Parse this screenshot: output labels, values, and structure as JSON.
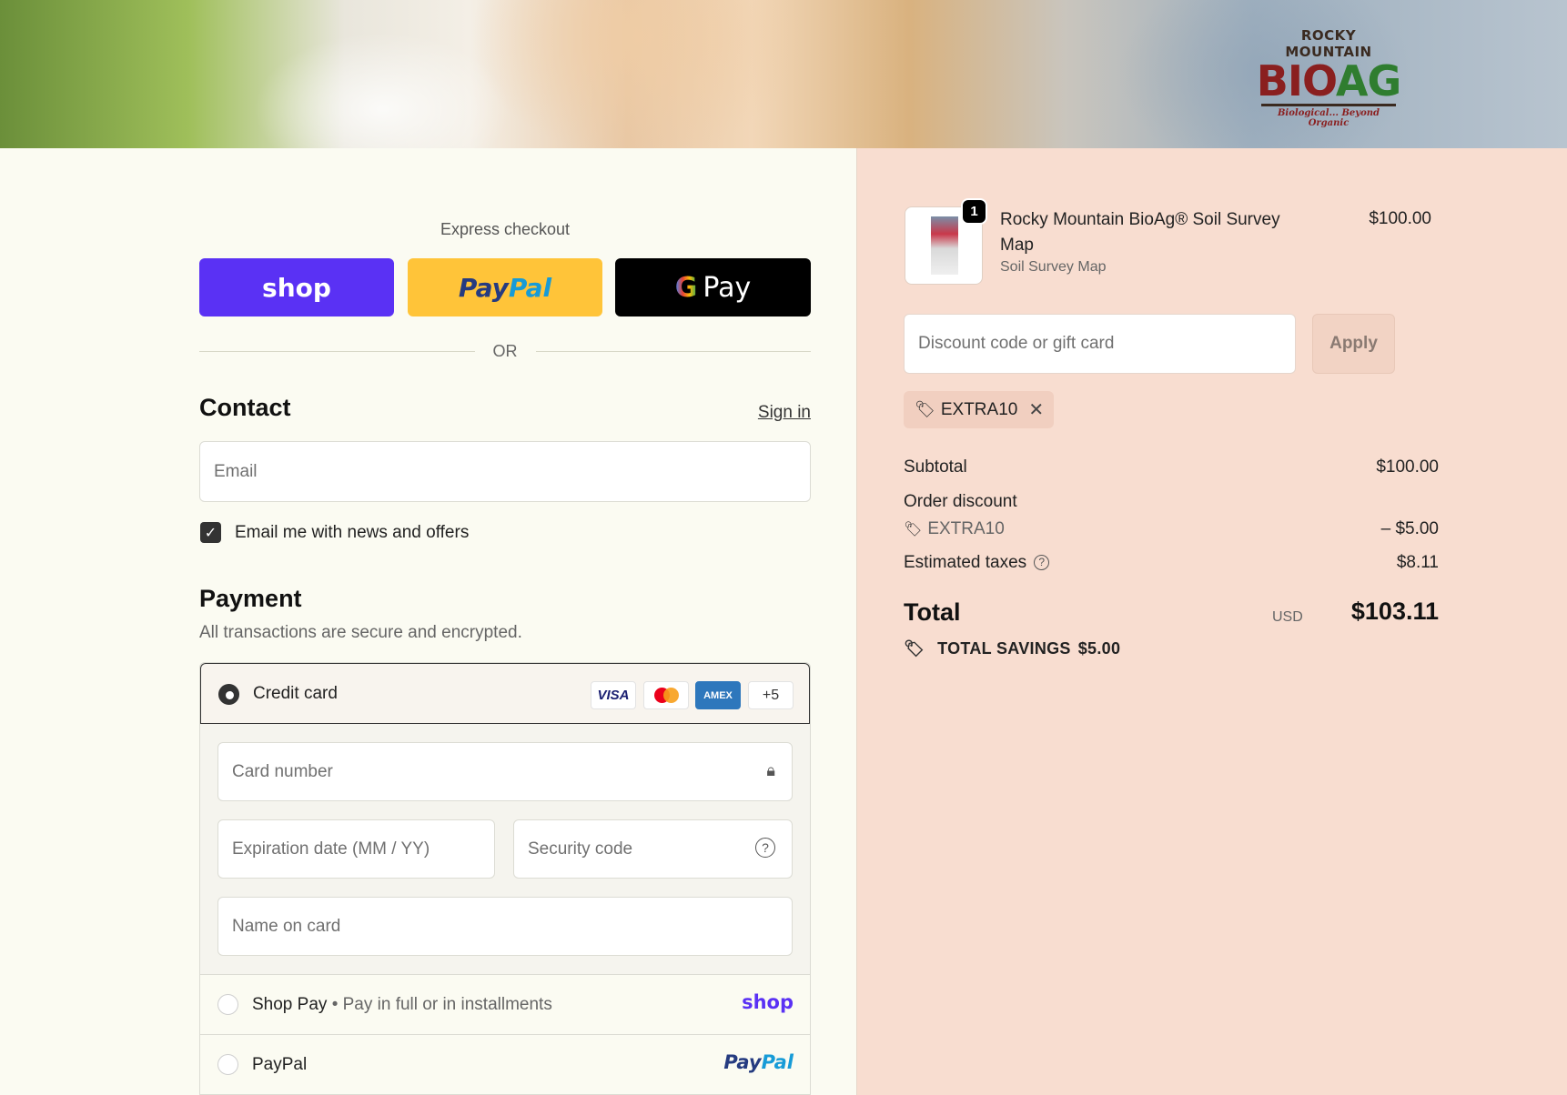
{
  "header": {
    "logo_top": "ROCKY MOUNTAIN",
    "logo_main_a": "BIO",
    "logo_main_b": "AG",
    "logo_sub": "Biological... Beyond Organic"
  },
  "express": {
    "title": "Express checkout",
    "shop_label": "shop",
    "paypal_a": "Pay",
    "paypal_b": "Pal",
    "gpay_g": "G",
    "gpay_label": "Pay",
    "or": "OR"
  },
  "contact": {
    "heading": "Contact",
    "signin": "Sign in",
    "email_placeholder": "Email",
    "newsletter_label": "Email me with news and offers",
    "newsletter_checked": true
  },
  "payment": {
    "heading": "Payment",
    "subtitle": "All transactions are secure and encrypted.",
    "credit_card_label": "Credit card",
    "cards": [
      "VISA",
      "AMEX",
      "+5"
    ],
    "card_number_placeholder": "Card number",
    "expiry_placeholder": "Expiration date (MM / YY)",
    "security_placeholder": "Security code",
    "name_placeholder": "Name on card",
    "shop_pay_label": "Shop Pay",
    "shop_pay_sep": "•",
    "shop_pay_note": "Pay in full or in installments",
    "shop_pay_brand": "shop",
    "paypal_label": "PayPal",
    "paypal_brand_a": "Pay",
    "paypal_brand_b": "Pal"
  },
  "order": {
    "quantity": "1",
    "product_name": "Rocky Mountain BioAg® Soil Survey Map",
    "product_variant": "Soil Survey Map",
    "product_price": "$100.00",
    "discount_placeholder": "Discount code or gift card",
    "apply_label": "Apply",
    "applied_code": "EXTRA10",
    "subtotal_label": "Subtotal",
    "subtotal_value": "$100.00",
    "order_discount_label": "Order discount",
    "discount_code": "EXTRA10",
    "discount_value": "– $5.00",
    "taxes_label": "Estimated taxes",
    "taxes_value": "$8.11",
    "total_label": "Total",
    "currency": "USD",
    "total_value": "$103.11",
    "savings_label": "TOTAL SAVINGS",
    "savings_value": "$5.00"
  },
  "colors": {
    "shop": "#5a31f4",
    "paypal": "#ffc439",
    "left_bg": "#fbfbf2",
    "right_bg": "#f8ddd0"
  }
}
